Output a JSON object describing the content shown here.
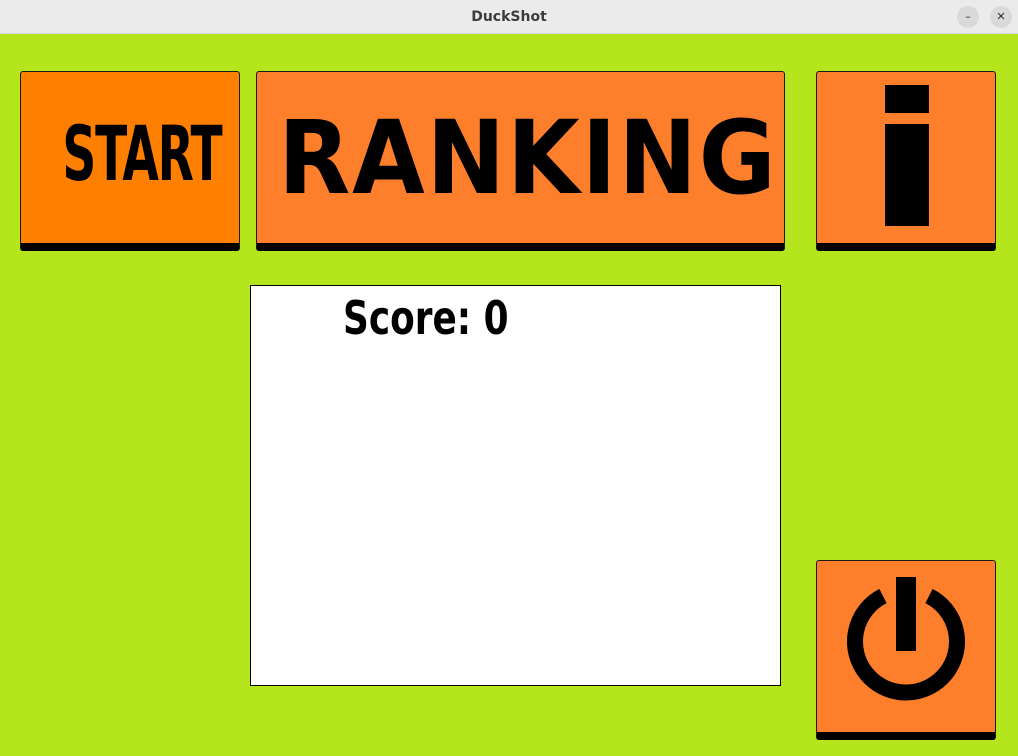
{
  "window": {
    "title": "DuckShot",
    "minimize_glyph": "–",
    "close_glyph": "✕"
  },
  "colors": {
    "background": "#b5e51d",
    "button": "#fe7f2b",
    "start_button": "#ff7f00",
    "panel": "#ffffff",
    "ink": "#000000"
  },
  "menu": {
    "start_label": "START",
    "ranking_label": "RANKING",
    "info_icon": "info-i-icon",
    "power_icon": "power-icon"
  },
  "score_panel": {
    "label": "Score: 0"
  }
}
